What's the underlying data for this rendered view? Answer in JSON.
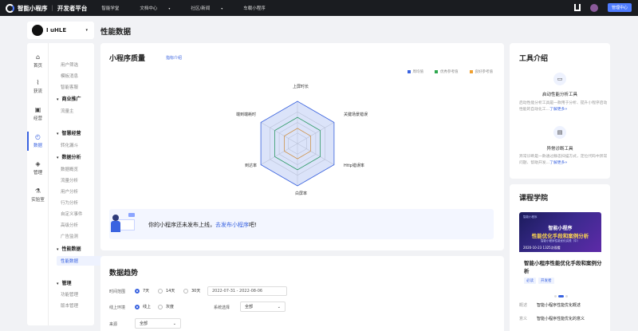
{
  "topbar": {
    "brand": "智能小程序",
    "platform": "开发者平台",
    "nav": [
      {
        "label": "智能学堂",
        "caret": ""
      },
      {
        "label": "文档中心",
        "caret": "▾"
      },
      {
        "label": "社区/新闻",
        "caret": "▾"
      },
      {
        "label": "车载小程序",
        "caret": ""
      }
    ],
    "manage_label": "管理中心"
  },
  "account": {
    "name": "I uHLE",
    "caret": "▾"
  },
  "page_title": "性能数据",
  "rail": [
    {
      "label": "首页",
      "icon": "⌂"
    },
    {
      "label": "获流",
      "icon": "⌇"
    },
    {
      "label": "经营",
      "icon": "▣"
    },
    {
      "label": "数据",
      "icon": "◴"
    },
    {
      "label": "管理",
      "icon": "◈"
    },
    {
      "label": "实验室",
      "icon": "⚗"
    }
  ],
  "menu": {
    "items_top": [
      "用户筛选",
      "模板消息",
      "智能客服"
    ],
    "group_business": "商业推广",
    "business_items": [
      "流量主"
    ],
    "group_smart": "智慧经营",
    "smart_items": [
      "转化漏斗"
    ],
    "group_analysis": "数据分析",
    "analysis_items": [
      "数据概览",
      "流量分析",
      "用户分析",
      "行为分析",
      "自定义事件",
      "高级分析",
      "广告监测"
    ],
    "group_perf": "性能数据",
    "perf_active": "性能数据",
    "group_manage": "管理",
    "manage_items": [
      "功能管理",
      "版本管理"
    ]
  },
  "quality": {
    "title": "小程序质量",
    "link": "指标介绍",
    "legend": [
      "周均值",
      "优秀参考值",
      "良好参考值"
    ],
    "colors": {
      "avg": "#3a63e0",
      "excellent": "#2fa84f",
      "good": "#f0a030"
    },
    "axes": [
      "上屏时长",
      "关键场景错误",
      "Http错误率",
      "白屏率",
      "到达率",
      "端到端耗时"
    ]
  },
  "banner": {
    "prefix": "你的小程序还未发布上线，",
    "link": "去发布小程序",
    "suffix": "吧!"
  },
  "trend": {
    "title": "数据趋势",
    "time_label": "时间范围",
    "time_options": [
      "7天",
      "14天",
      "30天"
    ],
    "time_selected": "7天",
    "date_range": "2022-07-31 - 2022-08-06",
    "env_label": "线上环境",
    "env_options": [
      "线上",
      "灰度"
    ],
    "env_selected": "线上",
    "sys_label": "系统选择",
    "sys_value": "全部",
    "source_label": "来源",
    "source_value": "全部"
  },
  "tools": {
    "title": "工具介绍",
    "items": [
      {
        "icon": "▭",
        "name": "启动性能分析工具",
        "desc": "启动性能分析工具是一款用于分析、提升小程序启动性能的自动化工...",
        "more": "了解更多»"
      },
      {
        "icon": "▤",
        "name": "异常诊断工具",
        "desc": "异常诊断是一款通过静态扫描方式，定位代码中异常问题、帮助开发...",
        "more": "了解更多»"
      }
    ]
  },
  "course": {
    "title": "课程学院",
    "img_brand": "智能小程序",
    "img_line1": "智能小程序",
    "img_line2": "性能优化手段和案例分析",
    "img_line3": "智能小程序性能优化实践（中）",
    "img_date": "2020-10-23   1325次观看",
    "name": "智能小程序性能优化手段和案例分析",
    "tags": [
      "必读",
      "开发者"
    ],
    "rows": [
      {
        "label": "概述",
        "value": "智能小程序性能优化概述"
      },
      {
        "label": "意义",
        "value": "智能小程序性能优化的意义"
      }
    ]
  }
}
